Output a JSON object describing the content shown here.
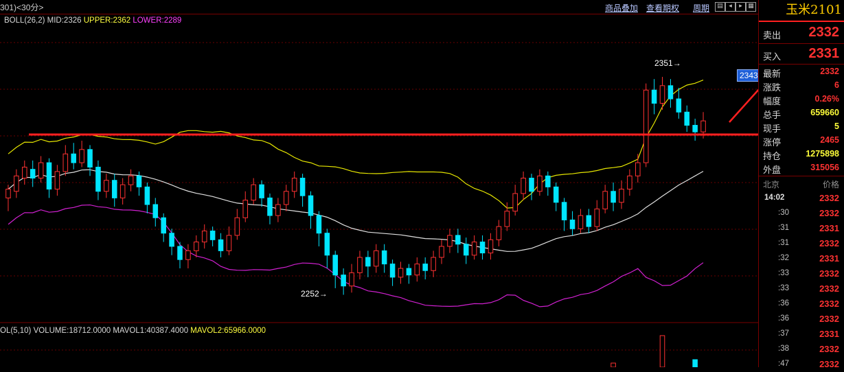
{
  "header": {
    "title": "301)<30分>",
    "menus": [
      "商品叠加",
      "查看期权",
      "周期"
    ],
    "icons": [
      "chart-icon",
      "prev-icon",
      "next-icon",
      "grid-icon"
    ]
  },
  "boll": {
    "label": "BOLL(26,2)",
    "mid": "MID:2326",
    "upper": "UPPER:2362",
    "lower": "LOWER:2289"
  },
  "volume": {
    "label": "OL(5,10)",
    "volume": "VOLUME:18712.0000",
    "mavol1": "MAVOL1:40387.4000",
    "mavol2": "MAVOL2:65966.0000"
  },
  "annotations": {
    "high": "2351→",
    "low": "2252→",
    "current_tag": "2343"
  },
  "colors": {
    "up": "#ff3232",
    "down": "#00e5ff",
    "upper_band": "#e6e600",
    "mid_band": "#e0e0e0",
    "lower_band": "#d020d0",
    "support_line": "#ff2020"
  },
  "quote": {
    "symbol": "玉米2101",
    "ask_label": "卖出",
    "ask": "2332",
    "bid_label": "买入",
    "bid": "2331",
    "stats": [
      {
        "label": "最新",
        "value": "2332",
        "color": "red"
      },
      {
        "label": "涨跌",
        "value": "6",
        "color": "red"
      },
      {
        "label": "幅度",
        "value": "0.26%",
        "color": "red"
      },
      {
        "label": "总手",
        "value": "659660",
        "color": "yel"
      },
      {
        "label": "现手",
        "value": "5",
        "color": "yel"
      },
      {
        "label": "涨停",
        "value": "2465",
        "color": "red"
      },
      {
        "label": "持仓",
        "value": "1275898",
        "color": "yel"
      },
      {
        "label": "外盘",
        "value": "315056",
        "color": "red"
      }
    ]
  },
  "ticks": {
    "header_left": "北京",
    "header_right": "价格",
    "rows": [
      {
        "time": "14:02",
        "price": "2332"
      },
      {
        "time": ":30",
        "price": "2332"
      },
      {
        "time": ":31",
        "price": "2331"
      },
      {
        "time": ":31",
        "price": "2332"
      },
      {
        "time": ":32",
        "price": "2331"
      },
      {
        "time": ":33",
        "price": "2332"
      },
      {
        "time": ":33",
        "price": "2332"
      },
      {
        "time": ":36",
        "price": "2332"
      },
      {
        "time": ":36",
        "price": "2332"
      },
      {
        "time": ":37",
        "price": "2331"
      },
      {
        "time": ":38",
        "price": "2332"
      },
      {
        "time": ":47",
        "price": "2332"
      }
    ]
  },
  "chart_data": {
    "type": "candlestick",
    "ylim": [
      2240,
      2375
    ],
    "support_level": 2315,
    "candles": [
      [
        2296,
        2300,
        2290,
        2302
      ],
      [
        2299,
        2306,
        2296,
        2309
      ],
      [
        2305,
        2310,
        2302,
        2313
      ],
      [
        2309,
        2305,
        2301,
        2313
      ],
      [
        2305,
        2312,
        2303,
        2315
      ],
      [
        2312,
        2300,
        2296,
        2314
      ],
      [
        2300,
        2308,
        2297,
        2311
      ],
      [
        2308,
        2316,
        2306,
        2320
      ],
      [
        2316,
        2312,
        2309,
        2321
      ],
      [
        2312,
        2318,
        2310,
        2322
      ],
      [
        2318,
        2310,
        2306,
        2320
      ],
      [
        2310,
        2299,
        2295,
        2313
      ],
      [
        2299,
        2304,
        2296,
        2307
      ],
      [
        2304,
        2296,
        2292,
        2307
      ],
      [
        2296,
        2302,
        2293,
        2305
      ],
      [
        2302,
        2306,
        2299,
        2309
      ],
      [
        2306,
        2301,
        2297,
        2308
      ],
      [
        2301,
        2293,
        2289,
        2303
      ],
      [
        2293,
        2287,
        2283,
        2296
      ],
      [
        2287,
        2280,
        2276,
        2289
      ],
      [
        2280,
        2274,
        2270,
        2282
      ],
      [
        2274,
        2268,
        2264,
        2276
      ],
      [
        2268,
        2272,
        2264,
        2275
      ],
      [
        2272,
        2276,
        2269,
        2279
      ],
      [
        2276,
        2281,
        2273,
        2284
      ],
      [
        2281,
        2277,
        2274,
        2283
      ],
      [
        2277,
        2272,
        2269,
        2280
      ],
      [
        2272,
        2279,
        2270,
        2283
      ],
      [
        2279,
        2287,
        2277,
        2291
      ],
      [
        2287,
        2295,
        2285,
        2299
      ],
      [
        2295,
        2302,
        2293,
        2305
      ],
      [
        2302,
        2296,
        2292,
        2304
      ],
      [
        2296,
        2288,
        2284,
        2298
      ],
      [
        2288,
        2293,
        2285,
        2296
      ],
      [
        2293,
        2299,
        2290,
        2302
      ],
      [
        2299,
        2305,
        2296,
        2308
      ],
      [
        2305,
        2297,
        2292,
        2307
      ],
      [
        2297,
        2288,
        2282,
        2299
      ],
      [
        2288,
        2280,
        2274,
        2290
      ],
      [
        2280,
        2270,
        2264,
        2282
      ],
      [
        2270,
        2261,
        2255,
        2272
      ],
      [
        2261,
        2256,
        2252,
        2264
      ],
      [
        2256,
        2262,
        2253,
        2266
      ],
      [
        2262,
        2269,
        2259,
        2272
      ],
      [
        2269,
        2265,
        2260,
        2272
      ],
      [
        2265,
        2272,
        2262,
        2275
      ],
      [
        2272,
        2266,
        2262,
        2275
      ],
      [
        2266,
        2260,
        2256,
        2268
      ],
      [
        2260,
        2264,
        2257,
        2267
      ],
      [
        2264,
        2261,
        2257,
        2266
      ],
      [
        2261,
        2266,
        2258,
        2269
      ],
      [
        2266,
        2263,
        2259,
        2269
      ],
      [
        2263,
        2269,
        2260,
        2272
      ],
      [
        2269,
        2274,
        2266,
        2277
      ],
      [
        2274,
        2279,
        2271,
        2282
      ],
      [
        2279,
        2275,
        2271,
        2282
      ],
      [
        2275,
        2270,
        2266,
        2278
      ],
      [
        2270,
        2276,
        2268,
        2279
      ],
      [
        2276,
        2271,
        2268,
        2279
      ],
      [
        2271,
        2277,
        2268,
        2280
      ],
      [
        2277,
        2283,
        2274,
        2286
      ],
      [
        2283,
        2290,
        2281,
        2294
      ],
      [
        2290,
        2298,
        2288,
        2302
      ],
      [
        2298,
        2305,
        2295,
        2308
      ],
      [
        2305,
        2299,
        2295,
        2307
      ],
      [
        2299,
        2306,
        2297,
        2309
      ],
      [
        2306,
        2301,
        2297,
        2308
      ],
      [
        2301,
        2294,
        2290,
        2303
      ],
      [
        2294,
        2286,
        2281,
        2296
      ],
      [
        2286,
        2282,
        2279,
        2290
      ],
      [
        2282,
        2288,
        2280,
        2291
      ],
      [
        2288,
        2283,
        2280,
        2291
      ],
      [
        2283,
        2291,
        2281,
        2295
      ],
      [
        2291,
        2299,
        2289,
        2302
      ],
      [
        2299,
        2294,
        2290,
        2303
      ],
      [
        2294,
        2300,
        2291,
        2304
      ],
      [
        2300,
        2306,
        2297,
        2309
      ],
      [
        2306,
        2312,
        2303,
        2316
      ],
      [
        2312,
        2345,
        2310,
        2348
      ],
      [
        2345,
        2339,
        2334,
        2350
      ],
      [
        2339,
        2347,
        2336,
        2351
      ],
      [
        2347,
        2341,
        2337,
        2350
      ],
      [
        2341,
        2335,
        2332,
        2346
      ],
      [
        2335,
        2329,
        2326,
        2338
      ],
      [
        2329,
        2326,
        2322,
        2332
      ],
      [
        2326,
        2331,
        2323,
        2335
      ]
    ]
  }
}
